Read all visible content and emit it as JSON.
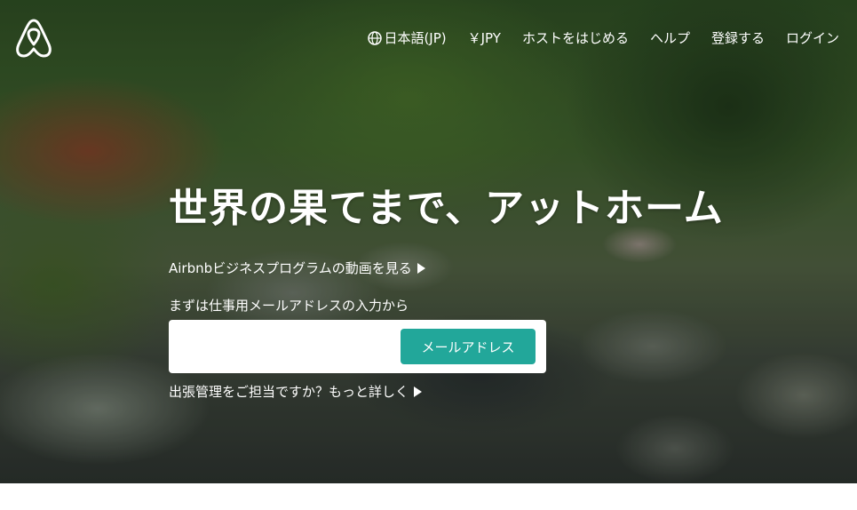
{
  "brand": {
    "logo_icon": "airbnb-belo-icon",
    "accent_color": "#22a79a"
  },
  "nav": {
    "language": "日本語(JP)",
    "currency": "￥JPY",
    "host": "ホストをはじめる",
    "help": "ヘルプ",
    "signup": "登録する",
    "login": "ログイン"
  },
  "hero": {
    "headline": "世界の果てまで、アットホーム",
    "video_link": "Airbnbビジネスプログラムの動画を見る",
    "email_label": "まずは仕事用メールアドレスの入力から",
    "email_value": "",
    "email_button": "メールアドレス",
    "business_link": "出張管理をご担当ですか？もっと詳しく"
  }
}
